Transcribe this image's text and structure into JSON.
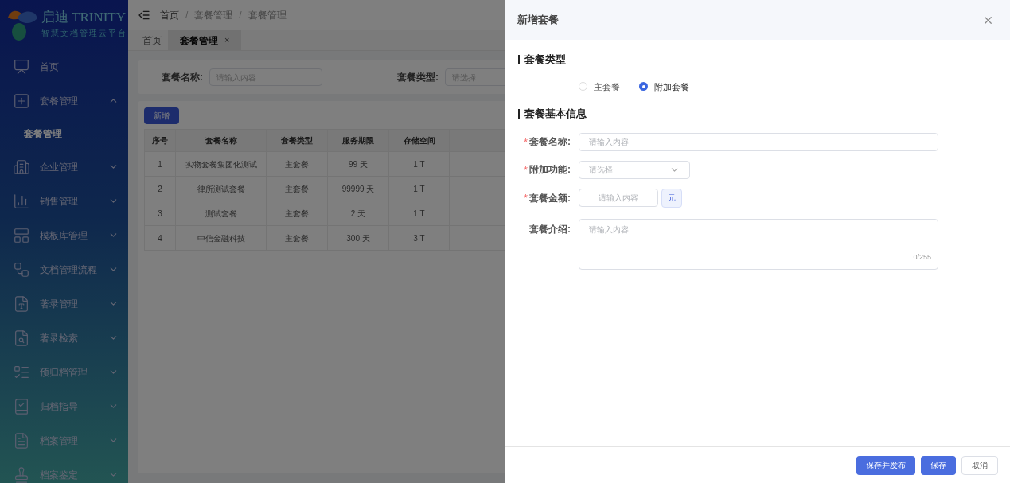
{
  "logo": {
    "brand": "启迪",
    "name": "TRINITY",
    "subtitle": "智慧文档管理云平台"
  },
  "sidebar": {
    "items": [
      {
        "label": "首页",
        "kind": "link"
      },
      {
        "label": "套餐管理",
        "kind": "group",
        "expanded": true,
        "children": [
          {
            "label": "套餐管理",
            "selected": true
          }
        ]
      },
      {
        "label": "企业管理",
        "kind": "group",
        "expanded": false
      },
      {
        "label": "销售管理",
        "kind": "group",
        "expanded": false
      },
      {
        "label": "模板库管理",
        "kind": "group",
        "expanded": false
      },
      {
        "label": "文档管理流程",
        "kind": "group",
        "expanded": false
      },
      {
        "label": "著录管理",
        "kind": "group",
        "expanded": false
      },
      {
        "label": "著录检索",
        "kind": "group",
        "expanded": false
      },
      {
        "label": "预归档管理",
        "kind": "group",
        "expanded": false
      },
      {
        "label": "归档指导",
        "kind": "group",
        "expanded": false
      },
      {
        "label": "档案管理",
        "kind": "group",
        "expanded": false
      },
      {
        "label": "档案鉴定",
        "kind": "group",
        "expanded": false
      }
    ]
  },
  "breadcrumb": [
    "首页",
    "套餐管理",
    "套餐管理"
  ],
  "breadcrumb_separator": "/",
  "tabs": [
    {
      "label": "首页",
      "selected": false
    },
    {
      "label": "套餐管理",
      "selected": true,
      "close": "×"
    }
  ],
  "filters": [
    {
      "label": "套餐名称:",
      "placeholder": "请输入内容"
    },
    {
      "label": "套餐类型:",
      "placeholder": "请选择"
    }
  ],
  "add_button": "新增",
  "table": {
    "columns": [
      "序号",
      "套餐名称",
      "套餐类型",
      "服务期限",
      "存储空间"
    ],
    "rows": [
      [
        "1",
        "实物套餐集团化测试",
        "主套餐",
        "99 天",
        "1 T"
      ],
      [
        "2",
        "律所测试套餐",
        "主套餐",
        "99999 天",
        "1 T"
      ],
      [
        "3",
        "测试套餐",
        "主套餐",
        "2 天",
        "1 T"
      ],
      [
        "4",
        "中信金融科技",
        "主套餐",
        "300 天",
        "3 T"
      ]
    ]
  },
  "drawer": {
    "title": "新增套餐",
    "sections": [
      {
        "title": "套餐类型"
      },
      {
        "title": "套餐基本信息"
      }
    ],
    "radios": [
      {
        "label": "主套餐",
        "selected": false
      },
      {
        "label": "附加套餐",
        "selected": true
      }
    ],
    "fields": [
      {
        "kind": "input",
        "label": "套餐名称:",
        "required_mark": "*",
        "placeholder": "请输入内容"
      },
      {
        "kind": "select",
        "label": "附加功能:",
        "required_mark": "*",
        "placeholder": "请选择"
      },
      {
        "kind": "amount",
        "label": "套餐金额:",
        "required_mark": "*",
        "placeholder": "请输入内容",
        "suffix": "元"
      },
      {
        "kind": "textarea",
        "label": "套餐介绍:",
        "placeholder": "请输入内容",
        "counter": "0/255"
      }
    ],
    "buttons": [
      {
        "label": "保存并发布",
        "kind": "primary"
      },
      {
        "label": "保存",
        "kind": "primary"
      },
      {
        "label": "取消",
        "kind": "default"
      }
    ]
  }
}
